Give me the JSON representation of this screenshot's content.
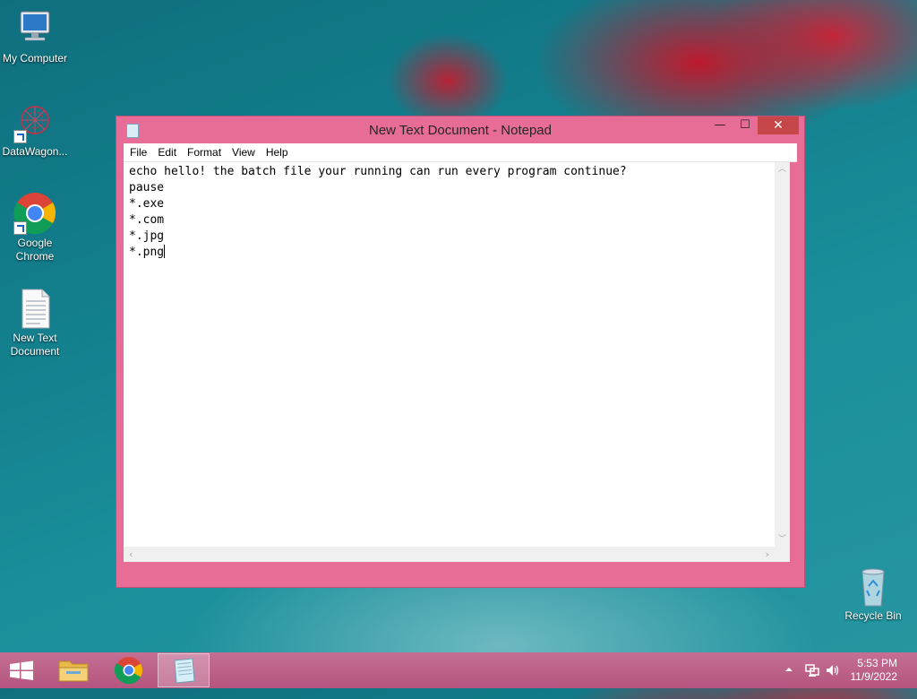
{
  "desktop": {
    "icons": [
      {
        "label": "My Computer",
        "icon": "computer-icon"
      },
      {
        "label": "DataWagon...",
        "icon": "datawagon-icon"
      },
      {
        "label": "Google Chrome",
        "icon": "chrome-icon"
      },
      {
        "label": "New Text Document",
        "icon": "text-file-icon"
      },
      {
        "label": "Recycle Bin",
        "icon": "recycle-bin-icon"
      }
    ]
  },
  "notepad": {
    "title": "New Text Document - Notepad",
    "controls": {
      "minimize": "—",
      "maximize": "☐",
      "close": "✕"
    },
    "menu": [
      "File",
      "Edit",
      "Format",
      "View",
      "Help"
    ],
    "lines": [
      "echo hello! the batch file your running can run every program continue?",
      "pause",
      "*.exe",
      "*.com",
      "*.jpg",
      "*.png"
    ]
  },
  "taskbar": {
    "buttons": [
      "start-button",
      "file-explorer",
      "google-chrome",
      "notepad"
    ],
    "active": "notepad",
    "clock": {
      "time": "5:53 PM",
      "date": "11/9/2022"
    }
  },
  "colors": {
    "window_frame": "#e76d96",
    "close_button": "#c7464a",
    "taskbar": "#b5557f",
    "desktop": "#13808e"
  }
}
